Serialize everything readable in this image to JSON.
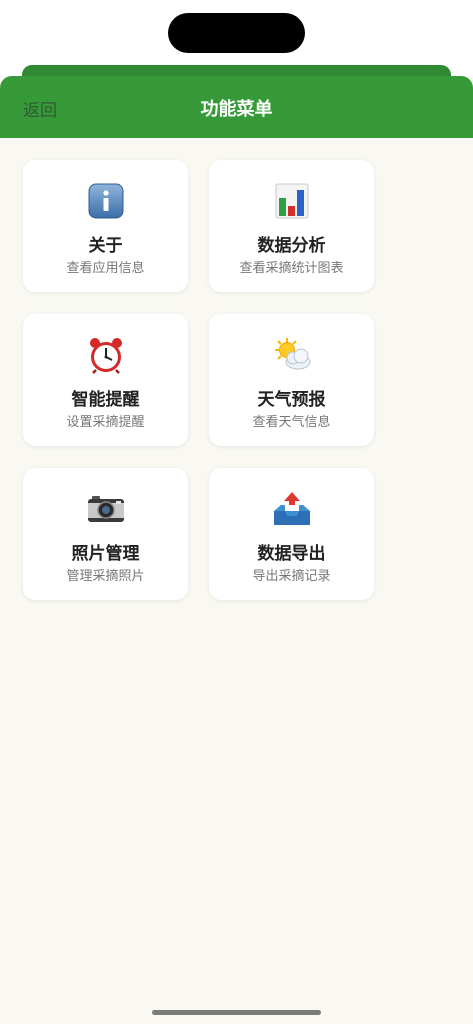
{
  "nav": {
    "back_label": "返回",
    "title": "功能菜单"
  },
  "cards": [
    {
      "title": "关于",
      "subtitle": "查看应用信息",
      "icon": "info-icon"
    },
    {
      "title": "数据分析",
      "subtitle": "查看采摘统计图表",
      "icon": "bar-chart-icon"
    },
    {
      "title": "智能提醒",
      "subtitle": "设置采摘提醒",
      "icon": "alarm-clock-icon"
    },
    {
      "title": "天气预报",
      "subtitle": "查看天气信息",
      "icon": "sun-cloud-icon"
    },
    {
      "title": "照片管理",
      "subtitle": "管理采摘照片",
      "icon": "camera-icon"
    },
    {
      "title": "数据导出",
      "subtitle": "导出采摘记录",
      "icon": "outbox-tray-icon"
    }
  ],
  "colors": {
    "nav_green": "#359a37",
    "background": "#f9f8f2"
  }
}
